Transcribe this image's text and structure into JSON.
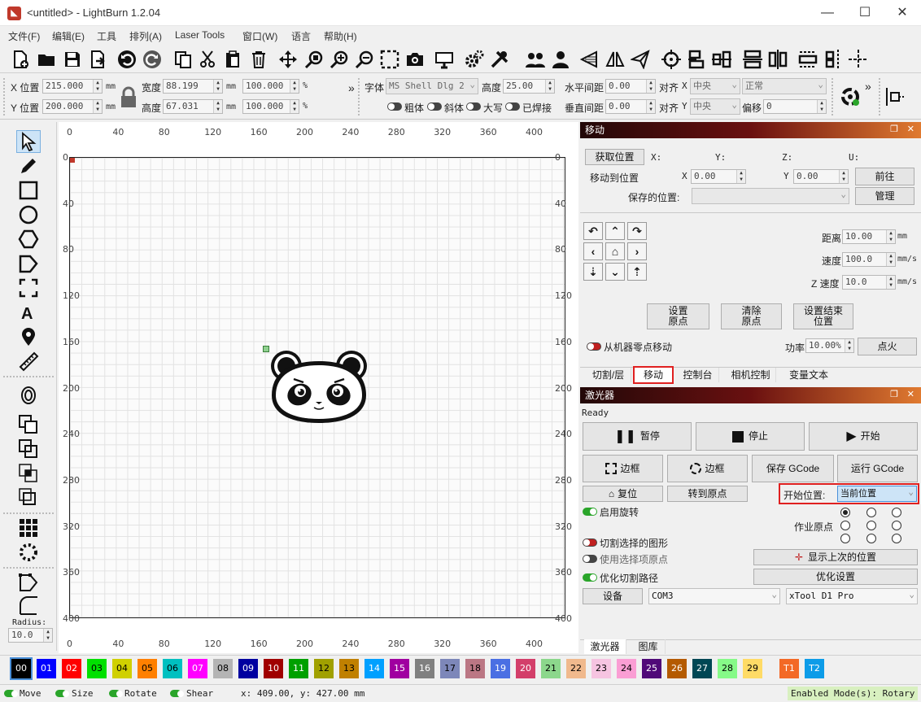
{
  "window": {
    "title": "<untitled> - LightBurn 1.2.04",
    "minimize": "—",
    "maximize": "☐",
    "close": "✕"
  },
  "menu": [
    "文件(F)",
    "编辑(E)",
    "工具",
    "排列(A)",
    "Laser Tools",
    "窗口(W)",
    "语言",
    "帮助(H)"
  ],
  "toolbar_icons": [
    "new-file-icon",
    "open-folder-icon",
    "save-icon",
    "import-icon",
    "undo-icon",
    "redo-icon",
    "copy-icon",
    "cut-icon",
    "paste-icon",
    "delete-icon",
    "move-icon",
    "zoom-selection-icon",
    "zoom-in-icon",
    "zoom-out-icon",
    "zoom-frame-icon",
    "camera-icon",
    "monitor-icon",
    "settings-icon",
    "tools-icon",
    "group-icon",
    "ungroup-icon",
    "flip-h-icon",
    "mirror-icon",
    "send-icon",
    "target-icon",
    "align-icon",
    "align-center-icon",
    "dist-h-icon",
    "dist-v-icon",
    "dock-icon",
    "dist-icon",
    "center-icon"
  ],
  "props": {
    "x_label": "X 位置",
    "x_value": "215.000",
    "y_label": "Y 位置",
    "y_value": "200.000",
    "unit_mm": "mm",
    "width_label": "宽度",
    "width_value": "88.199",
    "height_label": "高度",
    "height_value": "67.031",
    "scale_w": "100.000",
    "scale_h": "100.000",
    "pct": "%",
    "font_label": "字体",
    "font_value": "MS Shell Dlg 2",
    "size_label": "高度",
    "size_value": "25.00",
    "hspace_label": "水平间距",
    "hspace_value": "0.00",
    "vspace_label": "垂直间距",
    "vspace_value": "0.00",
    "align_label": "对齐",
    "align_x_axis": "X",
    "align_x_value": "中央",
    "align_y_axis": "Y",
    "align_y_value": "中央",
    "style_value": "正常",
    "offset_label": "偏移",
    "offset_value": "0",
    "bold": "粗体",
    "italic": "斜体",
    "upper": "大写",
    "welded": "已焊接",
    "more": "»"
  },
  "left_tools": [
    "select-arrow-icon",
    "pen-icon",
    "rectangle-icon",
    "ellipse-icon",
    "polygon-icon",
    "pentagon-icon",
    "frame-icon",
    "text-icon",
    "position-pin-icon",
    "measure-icon",
    "offset-icon",
    "boolean-union-icon",
    "boolean-subtract-icon",
    "boolean-intersect-icon",
    "weld-icon",
    "grid-array-icon",
    "circular-array-icon",
    "node-edit-icon",
    "corner-icon"
  ],
  "radius": {
    "label": "Radius:",
    "value": "10.0"
  },
  "ruler": {
    "top": [
      "0",
      "40",
      "80",
      "120",
      "160",
      "200",
      "240",
      "280",
      "320",
      "360",
      "400"
    ],
    "left": [
      "0",
      "40",
      "80",
      "120",
      "160",
      "200",
      "240",
      "280",
      "320",
      "360",
      "400"
    ],
    "bottom": [
      "0",
      "40",
      "80",
      "120",
      "160",
      "200",
      "240",
      "280",
      "320",
      "360",
      "400"
    ]
  },
  "move_panel": {
    "title": "移动",
    "get_pos": "获取位置",
    "x_col": "X:",
    "y_col": "Y:",
    "z_col": "Z:",
    "u_col": "U:",
    "move_to": "移动到位置",
    "x_axis": "X",
    "x_val": "0.00",
    "y_axis": "Y",
    "y_val": "0.00",
    "go": "前往",
    "saved_label": "保存的位置:",
    "saved_value": "",
    "manage": "管理",
    "distance_label": "距离",
    "distance_val": "10.00",
    "distance_unit": "mm",
    "speed_label": "速度",
    "speed_val": "100.0",
    "speed_unit": "mm/s",
    "zspeed_label": "Z 速度",
    "zspeed_val": "10.0",
    "zspeed_unit": "mm/s",
    "set_origin": "设置\n原点",
    "clear_origin": "清除\n原点",
    "set_finish": "设置结束\n位置",
    "from_zero": "从机器零点移动",
    "power_label": "功率",
    "power_val": "10.00%",
    "fire": "点火"
  },
  "tabs": [
    "切割/层",
    "移动",
    "控制台",
    "相机控制",
    "变量文本"
  ],
  "laser_panel": {
    "title": "激光器",
    "status": "Ready",
    "pause": "暂停",
    "stop": "停止",
    "start": "开始",
    "frame1": "边框",
    "frame2": "边框",
    "save_gcode": "保存 GCode",
    "run_gcode": "运行 GCode",
    "home": "复位",
    "goto_origin": "转到原点",
    "start_from_label": "开始位置:",
    "start_from_value": "当前位置",
    "rotary": "启用旋转",
    "job_origin": "作业原点",
    "cut_selected": "切割选择的图形",
    "use_sel_origin": "使用选择项原点",
    "show_last": "显示上次的位置",
    "optimize": "优化切割路径",
    "optimize_settings": "优化设置",
    "devices": "设备",
    "port": "COM3",
    "machine": "xTool D1 Pro"
  },
  "bottom_tabs": [
    "激光器",
    "图库"
  ],
  "palette": [
    {
      "label": "00",
      "color": "#000000",
      "fg": "#ffffff"
    },
    {
      "label": "01",
      "color": "#0000ff",
      "fg": "#ffffff"
    },
    {
      "label": "02",
      "color": "#ff0000",
      "fg": "#ffffff"
    },
    {
      "label": "03",
      "color": "#00e000",
      "fg": "#000000"
    },
    {
      "label": "04",
      "color": "#d0d000",
      "fg": "#000000"
    },
    {
      "label": "05",
      "color": "#ff8000",
      "fg": "#000000"
    },
    {
      "label": "06",
      "color": "#00c0c0",
      "fg": "#000000"
    },
    {
      "label": "07",
      "color": "#ff00ff",
      "fg": "#ffffff"
    },
    {
      "label": "08",
      "color": "#b4b4b4",
      "fg": "#000000"
    },
    {
      "label": "09",
      "color": "#0000a0",
      "fg": "#ffffff"
    },
    {
      "label": "10",
      "color": "#a00000",
      "fg": "#ffffff"
    },
    {
      "label": "11",
      "color": "#00a000",
      "fg": "#ffffff"
    },
    {
      "label": "12",
      "color": "#a0a000",
      "fg": "#000000"
    },
    {
      "label": "13",
      "color": "#c08000",
      "fg": "#000000"
    },
    {
      "label": "14",
      "color": "#00a0ff",
      "fg": "#ffffff"
    },
    {
      "label": "15",
      "color": "#a000a0",
      "fg": "#ffffff"
    },
    {
      "label": "16",
      "color": "#808080",
      "fg": "#ffffff"
    },
    {
      "label": "17",
      "color": "#7d87b9",
      "fg": "#000000"
    },
    {
      "label": "18",
      "color": "#bb7784",
      "fg": "#000000"
    },
    {
      "label": "19",
      "color": "#4a6fe3",
      "fg": "#ffffff"
    },
    {
      "label": "20",
      "color": "#d33f6a",
      "fg": "#ffffff"
    },
    {
      "label": "21",
      "color": "#8cd78c",
      "fg": "#000000"
    },
    {
      "label": "22",
      "color": "#f0b98d",
      "fg": "#000000"
    },
    {
      "label": "23",
      "color": "#f6c4e1",
      "fg": "#000000"
    },
    {
      "label": "24",
      "color": "#fa9ed4",
      "fg": "#000000"
    },
    {
      "label": "25",
      "color": "#500a78",
      "fg": "#ffffff"
    },
    {
      "label": "26",
      "color": "#b45a00",
      "fg": "#ffffff"
    },
    {
      "label": "27",
      "color": "#004754",
      "fg": "#ffffff"
    },
    {
      "label": "28",
      "color": "#86fa88",
      "fg": "#000000"
    },
    {
      "label": "29",
      "color": "#ffdb66",
      "fg": "#000000"
    },
    {
      "label": "T1",
      "color": "#f36926",
      "fg": "#ffffff"
    },
    {
      "label": "T2",
      "color": "#0d9ce8",
      "fg": "#ffffff"
    }
  ],
  "status": {
    "move": "Move",
    "size": "Size",
    "rotate": "Rotate",
    "shear": "Shear",
    "coords": "x: 409.00, y: 427.00 mm",
    "modes": "Enabled Mode(s): Rotary"
  }
}
